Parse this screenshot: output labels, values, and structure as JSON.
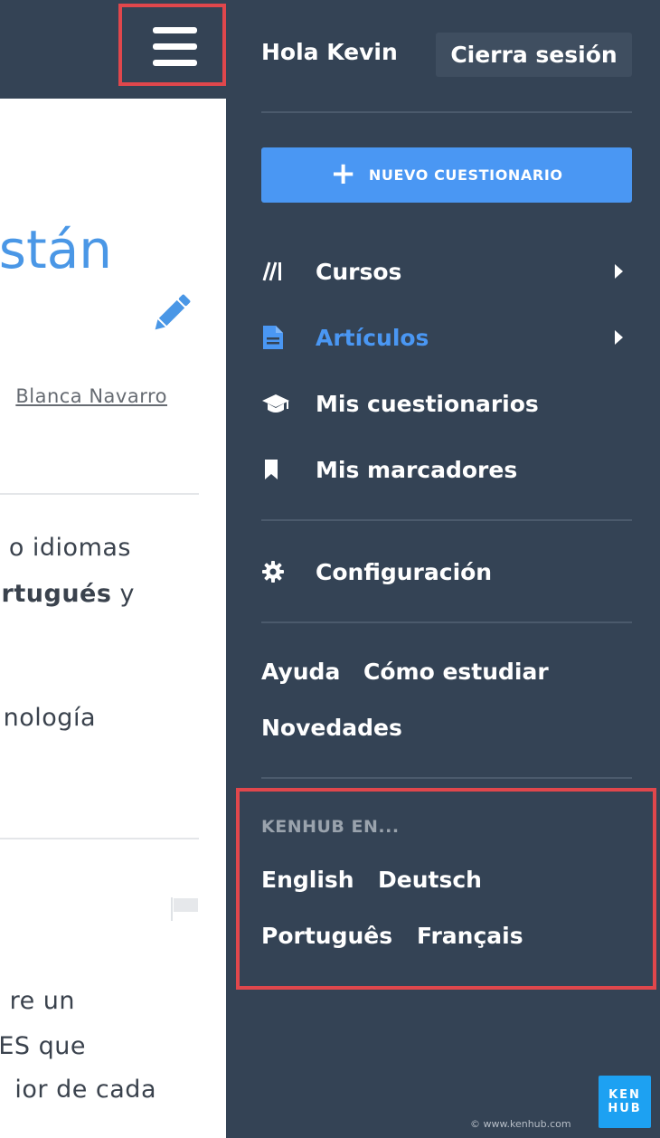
{
  "left_page": {
    "title_fragment": "stán",
    "author_fragment": " Blanca Navarro",
    "frag1": "o idiomas",
    "frag2_bold": "rtugués",
    "frag2_rest": " y",
    "frag3": "nología",
    "frag4": "re un",
    "frag5": "ES que",
    "frag6": "ior de cada"
  },
  "drawer": {
    "greeting": "Hola Kevin",
    "logout_label": "Cierra sesión",
    "new_quiz_label": "NUEVO CUESTIONARIO",
    "nav": [
      {
        "label": "Cursos",
        "icon": "courses-icon"
      },
      {
        "label": "Artículos",
        "icon": "article-icon",
        "active": true
      },
      {
        "label": "Mis cuestionarios",
        "icon": "graduation-cap-icon"
      },
      {
        "label": "Mis marcadores",
        "icon": "bookmark-icon"
      },
      {
        "label": "Configuración",
        "icon": "gear-icon"
      }
    ],
    "help_links": [
      "Ayuda",
      "Cómo estudiar",
      "Novedades"
    ],
    "languages_heading": "KENHUB EN...",
    "languages": [
      "English",
      "Deutsch",
      "Português",
      "Français"
    ],
    "copyright": "© www.kenhub.com",
    "logo_top": "KEN",
    "logo_bottom": "HUB"
  },
  "colors": {
    "drawer_bg": "#344355",
    "accent_blue": "#4a97f3",
    "highlight_red": "#e0474c",
    "logo_blue": "#1da1f2"
  }
}
